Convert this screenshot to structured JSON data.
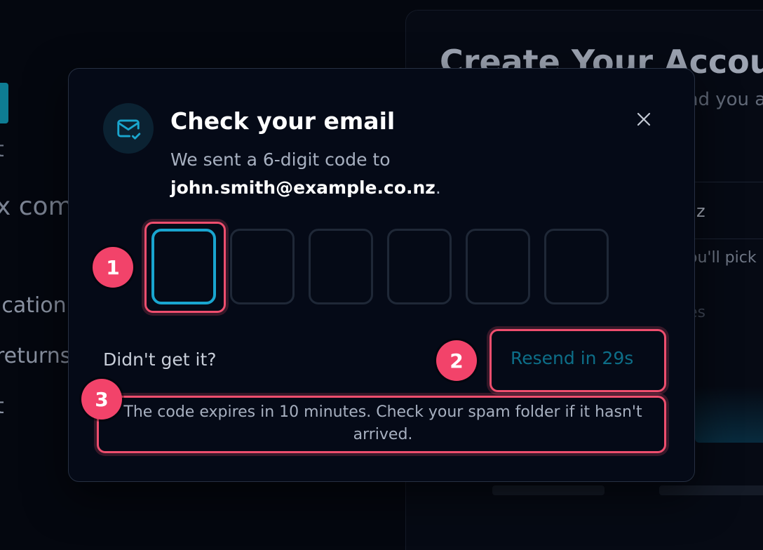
{
  "background": {
    "card_title": "Create Your Account",
    "card_subtitle_fragment": "nd you a",
    "field_fragment": "z",
    "hint_fragment": "ou'll pick",
    "hint2_fragment": "es",
    "left_fragment_1": "t",
    "left_fragment_2": "x com",
    "left_fragment_3": "ication",
    "left_fragment_4": "returns",
    "left_fragment_5": "t"
  },
  "modal": {
    "icon": "mail-check-icon",
    "title": "Check your email",
    "description_prefix": "We sent a 6-digit code to",
    "email": "john.smith@example.co.nz",
    "description_suffix": ".",
    "close_icon": "close-icon",
    "otp_length": 6,
    "resend_prompt": "Didn't get it?",
    "resend_button": "Resend in 29s",
    "expiry_note": "The code expires in 10 minutes. Check your spam folder if it hasn't arrived."
  },
  "annotations": [
    {
      "number": "1"
    },
    {
      "number": "2"
    },
    {
      "number": "3"
    }
  ],
  "colors": {
    "accent": "#19a5cf",
    "annotation": "#ee4e6e",
    "badge": "#f2436a",
    "resend_disabled": "#0d6e88"
  }
}
